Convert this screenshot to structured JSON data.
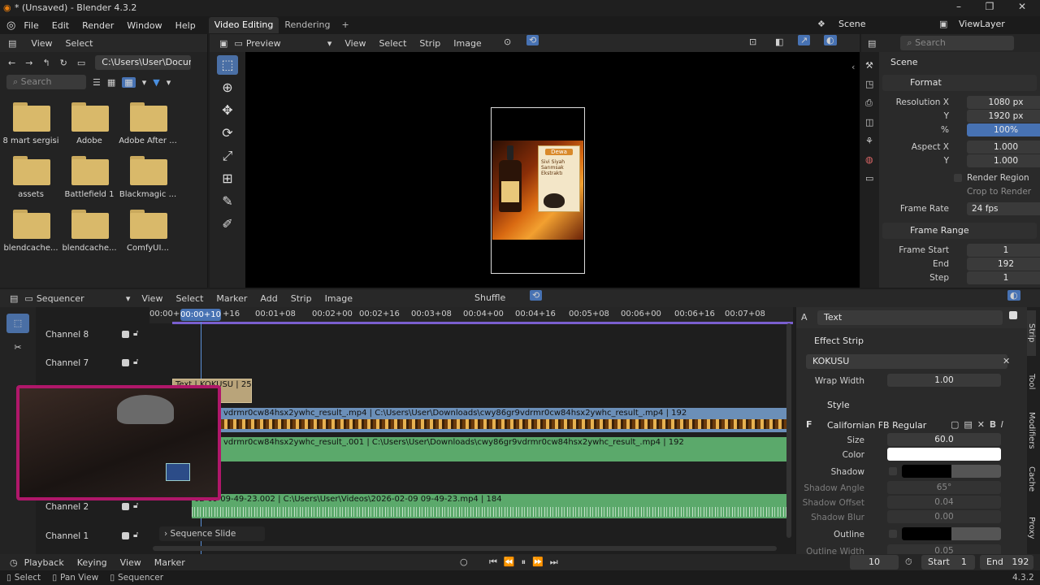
{
  "window": {
    "title": "* (Unsaved) - Blender 4.3.2",
    "controls": [
      "–",
      "❐",
      "✕"
    ]
  },
  "menubar": {
    "items": [
      "File",
      "Edit",
      "Render",
      "Window",
      "Help"
    ],
    "workspace_tabs": [
      "Video Editing",
      "Rendering"
    ],
    "add_tab": "+",
    "scene": "Scene",
    "view_layer": "ViewLayer"
  },
  "filebrowser": {
    "menu": [
      "View",
      "Select"
    ],
    "path": "C:\\Users\\User\\Docume...",
    "search_placeholder": "Search",
    "folders": [
      "8 mart sergisi",
      "Adobe",
      "Adobe After ...",
      "assets",
      "Battlefield 1",
      "Blackmagic ...",
      "blendcache...",
      "blendcache...",
      "ComfyUI..."
    ]
  },
  "preview_header": {
    "mode": "Preview",
    "menu": [
      "View",
      "Select",
      "Strip",
      "Image"
    ]
  },
  "properties": {
    "search_placeholder": "Search",
    "scene": "Scene",
    "format": {
      "title": "Format",
      "res_x_label": "Resolution X",
      "res_x": "1080 px",
      "res_y_label": "Y",
      "res_y": "1920 px",
      "pct_label": "%",
      "pct": "100%",
      "aspect_x_label": "Aspect X",
      "aspect_x": "1.000",
      "aspect_y_label": "Y",
      "aspect_y": "1.000",
      "render_region": "Render Region",
      "crop": "Crop to Render ...",
      "frame_rate_label": "Frame Rate",
      "frame_rate": "24 fps"
    },
    "frame_range": {
      "title": "Frame Range",
      "start_label": "Frame Start",
      "start": "1",
      "end_label": "End",
      "end": "192",
      "step_label": "Step",
      "step": "1"
    }
  },
  "sequencer": {
    "editor": "Sequencer",
    "menu": [
      "View",
      "Select",
      "Marker",
      "Add",
      "Strip",
      "Image"
    ],
    "shuffle": "Shuffle",
    "timecodes": [
      "00:00+0",
      "00:00+10",
      "+16",
      "00:01+08",
      "00:02+00",
      "00:02+16",
      "00:03+08",
      "00:04+00",
      "00:04+16",
      "00:05+08",
      "00:06+00",
      "00:06+16",
      "00:07+08"
    ],
    "current": "00:00+10",
    "channels": [
      "Channel 8",
      "Channel 7",
      "Channel 2",
      "Channel 1"
    ],
    "strips": {
      "text": "Text | KOKUSU | 25",
      "video": "vdrmr0cw84hsx2ywhc_result_.mp4 | C:\\Users\\User\\Downloads\\cwy86gr9vdrmr0cw84hsx2ywhc_result_.mp4 | 192",
      "audio1": "vdrmr0cw84hsx2ywhc_result_.001 | C:\\Users\\User\\Downloads\\cwy86gr9vdrmr0cw84hsx2ywhc_result_.mp4 | 192",
      "audio2": "02-09 09-49-23.002 | C:\\Users\\User\\Videos\\2026-02-09 09-49-23.mp4 | 184"
    },
    "slide_panel": "Sequence Slide"
  },
  "strip_panel": {
    "type": "Text",
    "section": "Effect Strip",
    "text_value": "KOKUSU",
    "wrap_width_label": "Wrap Width",
    "wrap_width": "1.00",
    "style": "Style",
    "font": "Californian FB Regular",
    "size_label": "Size",
    "size": "60.0",
    "color_label": "Color",
    "shadow_label": "Shadow",
    "shadow_angle_label": "Shadow Angle",
    "shadow_angle": "65°",
    "shadow_offset_label": "Shadow Offset",
    "shadow_offset": "0.04",
    "shadow_blur_label": "Shadow Blur",
    "shadow_blur": "0.00",
    "outline_label": "Outline",
    "outline_width_label": "Outline Width",
    "outline_width": "0.05",
    "tabs": [
      "Strip",
      "Tool",
      "Modifiers",
      "Cache",
      "Proxy"
    ]
  },
  "playback": {
    "menu": [
      "Playback",
      "Keying",
      "View",
      "Marker"
    ],
    "frame": "10",
    "start_label": "Start",
    "start": "1",
    "end_label": "End",
    "end": "192"
  },
  "status": {
    "items": [
      "Select",
      "Pan View",
      "Sequencer"
    ],
    "version": "4.3.2"
  },
  "product_image": {
    "brand": "Dewa",
    "label": "Sivi Siyah Sarımsak Ekstraktı"
  },
  "colors": {
    "accent": "#4772b3",
    "video_strip": "#6b8fb8",
    "audio_strip": "#5ba96b",
    "text_strip": "#b9a47a"
  }
}
